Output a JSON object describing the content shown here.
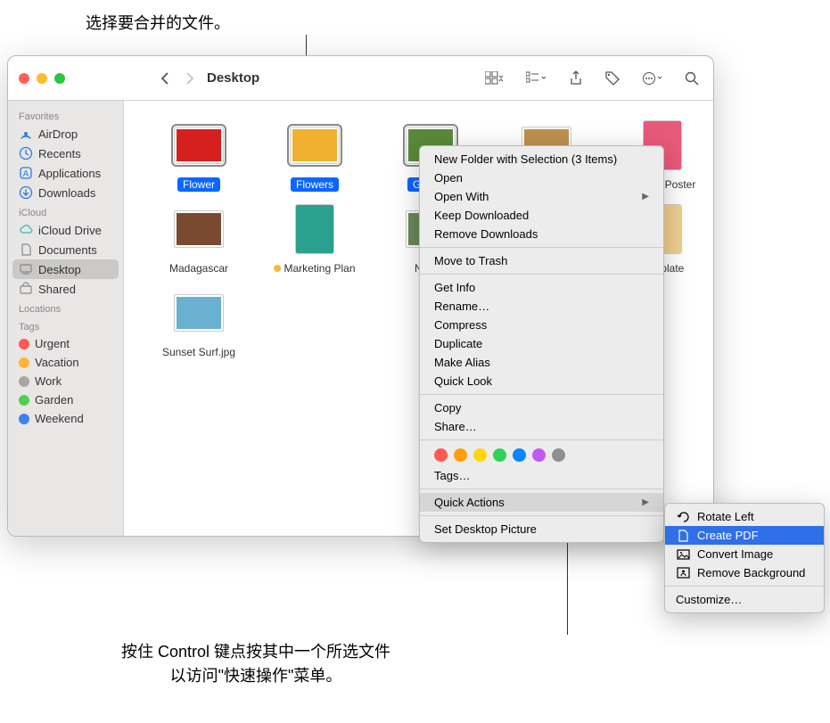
{
  "callouts": {
    "top": "选择要合并的文件。",
    "bottom_line1": "按住 Control 键点按其中一个所选文件",
    "bottom_line2": "以访问\"快速操作\"菜单。"
  },
  "window": {
    "title": "Desktop"
  },
  "sidebar": {
    "sections": {
      "favorites": "Favorites",
      "icloud": "iCloud",
      "locations": "Locations",
      "tags": "Tags"
    },
    "favorites": [
      {
        "label": "AirDrop",
        "icon": "airdrop"
      },
      {
        "label": "Recents",
        "icon": "clock"
      },
      {
        "label": "Applications",
        "icon": "apps"
      },
      {
        "label": "Downloads",
        "icon": "download"
      }
    ],
    "icloud": [
      {
        "label": "iCloud Drive",
        "icon": "cloud"
      },
      {
        "label": "Documents",
        "icon": "doc"
      },
      {
        "label": "Desktop",
        "icon": "desktop",
        "selected": true
      },
      {
        "label": "Shared",
        "icon": "shared"
      }
    ],
    "tags": [
      {
        "label": "Urgent",
        "color": "#ff5a50"
      },
      {
        "label": "Vacation",
        "color": "#ffb637"
      },
      {
        "label": "Work",
        "color": "#a6a6a6"
      },
      {
        "label": "Garden",
        "color": "#4fd052"
      },
      {
        "label": "Weekend",
        "color": "#3b82f6"
      }
    ]
  },
  "files": [
    {
      "name": "Flower",
      "type": "image",
      "selected": true,
      "fill": "#d62020"
    },
    {
      "name": "Flowers",
      "type": "image",
      "selected": true,
      "fill": "#f0b030"
    },
    {
      "name": "Garden",
      "type": "image",
      "selected": true,
      "fill": "#5a8a3a"
    },
    {
      "name": "",
      "type": "image",
      "fill": "#c09050"
    },
    {
      "name": "Market Poster",
      "type": "doc",
      "fill": "#e85a7a"
    },
    {
      "name": "Madagascar",
      "type": "image",
      "fill": "#7a4a30"
    },
    {
      "name": "Marketing Plan",
      "type": "doc",
      "tag": "#ffb637",
      "fill": "#2aa090"
    },
    {
      "name": "Nature",
      "type": "image",
      "fill": "#6a8a5a"
    },
    {
      "name": "",
      "type": "spacer"
    },
    {
      "name": "Template",
      "type": "doc",
      "fill": "#f0d090"
    },
    {
      "name": "Sunset Surf.jpg",
      "type": "image",
      "fill": "#6ab0d0"
    }
  ],
  "contextMenu": {
    "items": [
      {
        "label": "New Folder with Selection (3 Items)"
      },
      {
        "label": "Open"
      },
      {
        "label": "Open With",
        "submenu": true
      },
      {
        "label": "Keep Downloaded"
      },
      {
        "label": "Remove Downloads"
      },
      {
        "sep": true
      },
      {
        "label": "Move to Trash"
      },
      {
        "sep": true
      },
      {
        "label": "Get Info"
      },
      {
        "label": "Rename…"
      },
      {
        "label": "Compress"
      },
      {
        "label": "Duplicate"
      },
      {
        "label": "Make Alias"
      },
      {
        "label": "Quick Look"
      },
      {
        "sep": true
      },
      {
        "label": "Copy"
      },
      {
        "label": "Share…"
      },
      {
        "sep": true
      },
      {
        "colors": [
          "#ff5a50",
          "#ff9f0a",
          "#ffd60a",
          "#30d158",
          "#0a84ff",
          "#bf5af2",
          "#8e8e93"
        ]
      },
      {
        "label": "Tags…"
      },
      {
        "sep": true
      },
      {
        "label": "Quick Actions",
        "submenu": true,
        "highlighted": true
      },
      {
        "sep": true
      },
      {
        "label": "Set Desktop Picture"
      }
    ]
  },
  "submenu": {
    "items": [
      {
        "label": "Rotate Left",
        "icon": "rotate"
      },
      {
        "label": "Create PDF",
        "icon": "doc",
        "selected": true
      },
      {
        "label": "Convert Image",
        "icon": "image"
      },
      {
        "label": "Remove Background",
        "icon": "remove-bg"
      }
    ],
    "customize": "Customize…"
  }
}
